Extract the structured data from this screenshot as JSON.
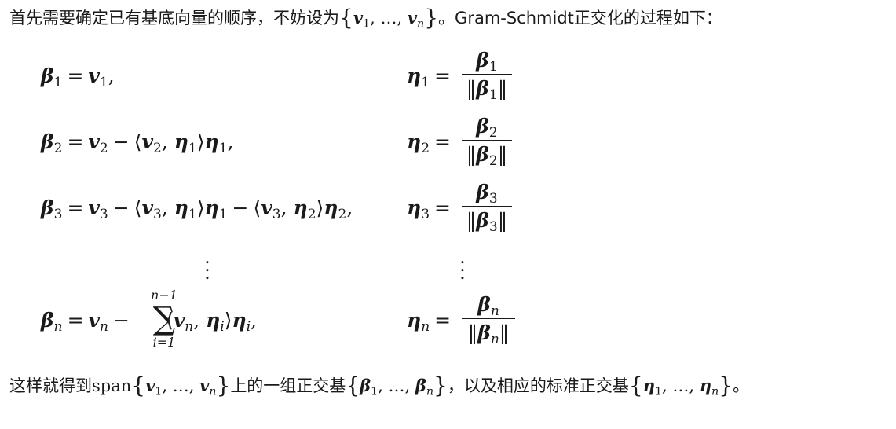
{
  "intro": {
    "prefix": "首先需要确定已有基底向量的顺序，不妨设为",
    "set_open": "{",
    "v": "v",
    "sub1": "1",
    "sep": ", …, ",
    "subn": "n",
    "set_close": "}",
    "suffix": "。Gram-Schmidt正交化的过程如下："
  },
  "symbols": {
    "beta": "β",
    "eta": "η",
    "v": "v",
    "equals": "=",
    "minus": "−",
    "comma": ",",
    "langle": "⟨",
    "rangle": "⟩",
    "norm": "‖",
    "vdots": "⋮",
    "sigma": "∑",
    "sum_upper": "n−1",
    "sum_lower": "i=1"
  },
  "subscripts": {
    "s1": "1",
    "s2": "2",
    "s3": "3",
    "sn": "n",
    "si": "i"
  },
  "outro": {
    "prefix": "这样就得到",
    "span": "span",
    "middle": "上的一组正交基",
    "middle2": "，以及相应的标准正交基",
    "end": "。"
  }
}
